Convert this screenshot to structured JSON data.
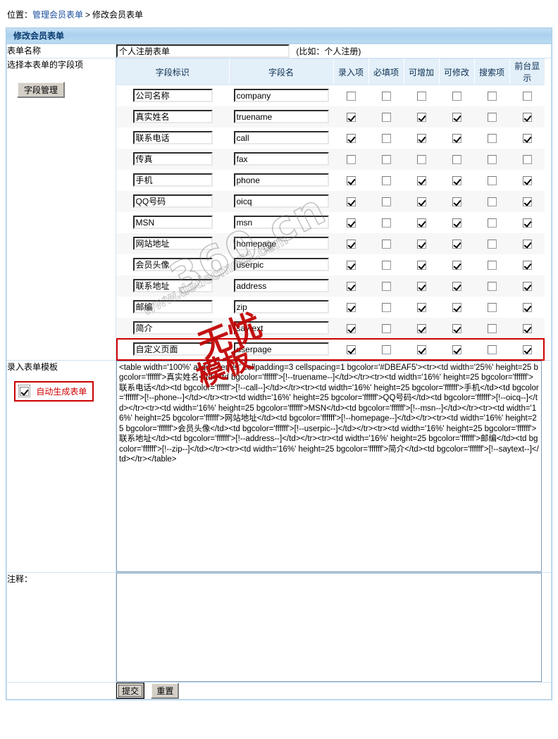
{
  "breadcrumb": {
    "prefix": "位置：",
    "link": "管理会员表单",
    "separator": ">",
    "current": "修改会员表单"
  },
  "panel": {
    "header": "修改会员表单"
  },
  "form": {
    "name_label": "表单名称",
    "name_value": "个人注册表单",
    "name_hint": "(比如：个人注册)",
    "fields_label": "选择本表单的字段项",
    "field_manage_button": "字段管理",
    "template_label": "录入表单模板",
    "auto_generate_label": "自动生成表单",
    "auto_generate_checked": true,
    "note_label": "注释：",
    "note_value": "",
    "submit_button": "提交",
    "reset_button": "重置"
  },
  "fields_table": {
    "columns": [
      "字段标识",
      "字段名",
      "录入项",
      "必填项",
      "可增加",
      "可修改",
      "搜索项",
      "前台显示"
    ],
    "rows": [
      {
        "ident": "公司名称",
        "name": "company",
        "flags": [
          false,
          false,
          false,
          false,
          false,
          false
        ],
        "highlight": false
      },
      {
        "ident": "真实姓名",
        "name": "truename",
        "flags": [
          true,
          false,
          true,
          true,
          false,
          true
        ],
        "highlight": false
      },
      {
        "ident": "联系电话",
        "name": "call",
        "flags": [
          true,
          false,
          true,
          true,
          false,
          true
        ],
        "highlight": false
      },
      {
        "ident": "传真",
        "name": "fax",
        "flags": [
          false,
          false,
          false,
          false,
          false,
          false
        ],
        "highlight": false
      },
      {
        "ident": "手机",
        "name": "phone",
        "flags": [
          true,
          false,
          true,
          true,
          false,
          true
        ],
        "highlight": false
      },
      {
        "ident": "QQ号码",
        "name": "oicq",
        "flags": [
          true,
          false,
          true,
          true,
          false,
          true
        ],
        "highlight": false
      },
      {
        "ident": "MSN",
        "name": "msn",
        "flags": [
          true,
          false,
          true,
          true,
          false,
          true
        ],
        "highlight": false
      },
      {
        "ident": "网站地址",
        "name": "homepage",
        "flags": [
          true,
          false,
          true,
          true,
          false,
          true
        ],
        "highlight": false
      },
      {
        "ident": "会员头像",
        "name": "userpic",
        "flags": [
          true,
          false,
          true,
          true,
          false,
          true
        ],
        "highlight": false
      },
      {
        "ident": "联系地址",
        "name": "address",
        "flags": [
          true,
          false,
          true,
          true,
          false,
          true
        ],
        "highlight": false
      },
      {
        "ident": "邮编",
        "name": "zip",
        "flags": [
          true,
          false,
          true,
          true,
          false,
          true
        ],
        "highlight": false
      },
      {
        "ident": "简介",
        "name": "saytext",
        "flags": [
          true,
          false,
          true,
          true,
          false,
          true
        ],
        "highlight": false
      },
      {
        "ident": "自定义页面",
        "name": "userpage",
        "flags": [
          true,
          false,
          true,
          true,
          false,
          true
        ],
        "highlight": true
      }
    ]
  },
  "template_code": "<table width='100%' align='center' cellpadding=3 cellspacing=1 bgcolor='#DBEAF5'><tr><td width='25%' height=25 bgcolor='ffffff'>真实姓名</td><td bgcolor='ffffff'>[!--truename--]</td></tr><tr><td width='16%' height=25 bgcolor='ffffff'>联系电话</td><td bgcolor='ffffff'>[!--call--]</td></tr><tr><td width='16%' height=25 bgcolor='ffffff'>手机</td><td bgcolor='ffffff'>[!--phone--]</td></tr><tr><td width='16%' height=25 bgcolor='ffffff'>QQ号码</td><td bgcolor='ffffff'>[!--oicq--]</td></tr><tr><td width='16%' height=25 bgcolor='ffffff'>MSN</td><td bgcolor='ffffff'>[!--msn--]</td></tr><tr><td width='16%' height=25 bgcolor='ffffff'>网站地址</td><td bgcolor='ffffff'>[!--homepage--]</td></tr><tr><td width='16%' height=25 bgcolor='ffffff'>会员头像</td><td bgcolor='ffffff'>[!--userpic--]</td></tr><tr><td width='16%' height=25 bgcolor='ffffff'>联系地址</td><td bgcolor='ffffff'>[!--address--]</td></tr><tr><td width='16%' height=25 bgcolor='ffffff'>邮编</td><td bgcolor='ffffff'>[!--zip--]</td></tr><tr><td width='16%' height=25 bgcolor='ffffff'>简介</td><td bgcolor='ffffff'>[!--saytext--]</td></tr></table>",
  "watermark": {
    "outline_main": "360.cn",
    "outline_sub": "www.dedecms51.com",
    "seal_line1": "无忧",
    "seal_line2": "模板"
  },
  "colors": {
    "panel_border": "#a8cce8",
    "header_blue": "#a9d0ee",
    "link_blue": "#1b4fa0",
    "highlight_red": "#cc0000",
    "row_alt": "#f7f7f7",
    "col_header_bg": "#e3eff9"
  }
}
